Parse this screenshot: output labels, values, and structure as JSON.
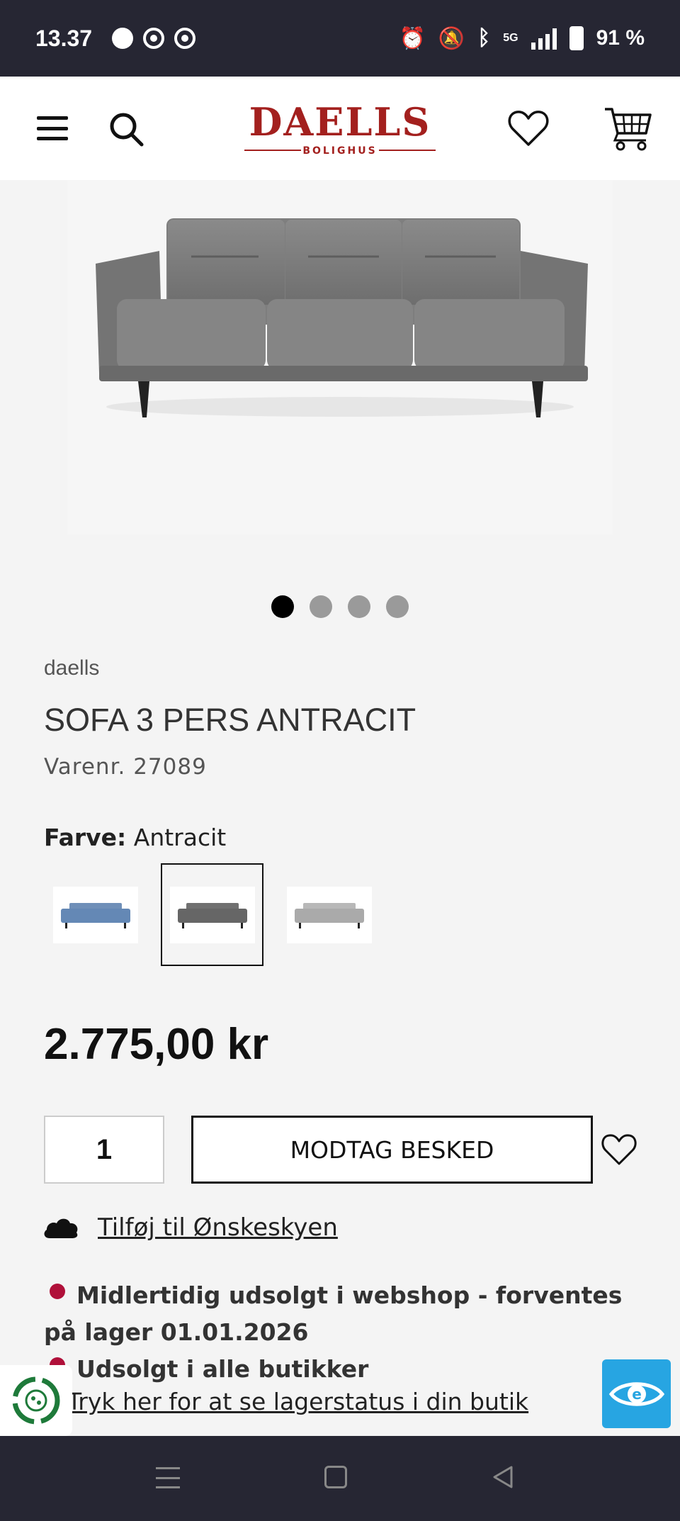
{
  "status_bar": {
    "time": "13.37",
    "network": "5G",
    "battery": "91 %"
  },
  "header": {
    "logo_main": "DAELLS",
    "logo_sub": "BOLIGHUS"
  },
  "product": {
    "image_alt": "Sofa 3 pers antracit",
    "brand": "daells",
    "title": "SOFA 3 PERS ANTRACIT",
    "sku": "Varenr. 27089",
    "color_label": "Farve:",
    "color_value": "Antracit",
    "swatches": [
      {
        "name": "blue",
        "color": "#6f8fb8"
      },
      {
        "name": "antracit",
        "color": "#6b6b6b",
        "selected": true
      },
      {
        "name": "light-grey",
        "color": "#b4b4b4"
      }
    ],
    "price": "2.775,00 kr",
    "quantity": "1",
    "notify_button": "MODTAG BESKED",
    "wishlist_link": "Tilføj til Ønskeskyen",
    "stock_webshop": "Midlertidig udsolgt i webshop - forventes på lager 01.01.2026",
    "stock_stores": "Udsolgt i alle butikker",
    "stock_link": "Tryk her for at se lagerstatus i din butik"
  },
  "carousel": {
    "count": 4,
    "active": 1
  },
  "colors": {
    "brand": "#a3201e",
    "stock_dot": "#b0103a",
    "accessibility": "#27a5e2",
    "status_bar": "#262633"
  }
}
